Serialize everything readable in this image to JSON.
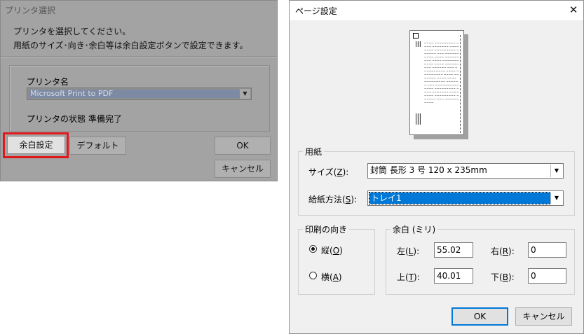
{
  "printer_dialog": {
    "title": "プリンタ選択",
    "instruction_line1": "プリンタを選択してください。",
    "instruction_line2": "用紙のサイズ･向き･余白等は余白設定ボタンで設定できます。",
    "printer_name_label": "プリンタ名",
    "printer_name_value": "Microsoft Print to PDF",
    "status_label": "プリンタの状態",
    "status_value": "準備完了",
    "margin_button": "余白設定",
    "default_button": "デフォルト",
    "ok_button": "OK",
    "cancel_button": "キャンセル",
    "highlight_color": "#e0191d"
  },
  "page_setup": {
    "title": "ページ設定",
    "close_symbol": "✕",
    "paper_group": "用紙",
    "size_label": "サイズ",
    "size_key": "Z",
    "size_value": "封筒 長形 3 号 120 x 235mm",
    "source_label": "給紙方法",
    "source_key": "S",
    "source_value": "トレイ1",
    "orientation_group": "印刷の向き",
    "portrait_label": "縦",
    "portrait_key": "O",
    "landscape_label": "横",
    "landscape_key": "A",
    "selected_orientation": "portrait",
    "margin_group": "余白 (ミリ)",
    "margin_left_label": "左",
    "margin_left_key": "L",
    "margin_left_value": "55.02",
    "margin_right_label": "右",
    "margin_right_key": "R",
    "margin_right_value": "0",
    "margin_top_label": "上",
    "margin_top_key": "T",
    "margin_top_value": "40.01",
    "margin_bottom_label": "下",
    "margin_bottom_key": "B",
    "margin_bottom_value": "0",
    "ok_button": "OK",
    "cancel_button": "キャンセル",
    "accent_color": "#0078d7"
  }
}
